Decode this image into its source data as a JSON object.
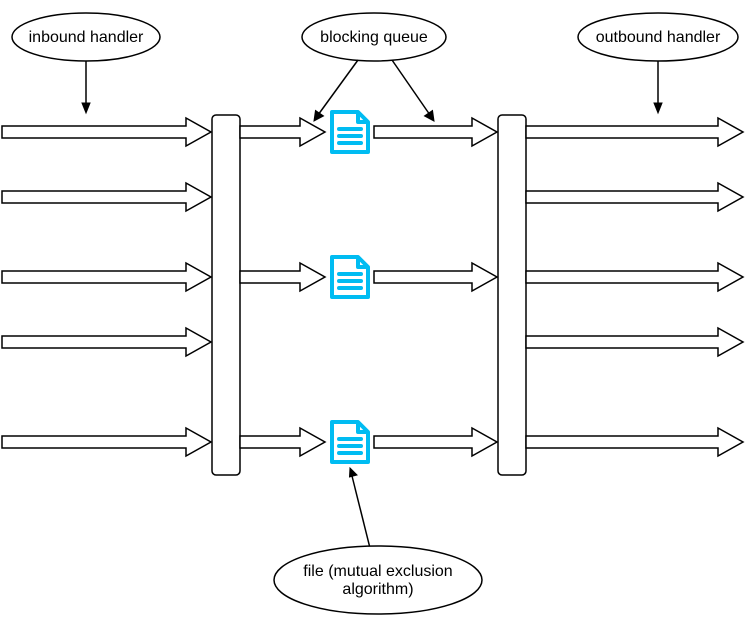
{
  "labels": {
    "inbound": "inbound handler",
    "blocking": "blocking queue",
    "outbound": "outbound handler",
    "file1": "file (mutual exclusion",
    "file2": "algorithm)"
  }
}
